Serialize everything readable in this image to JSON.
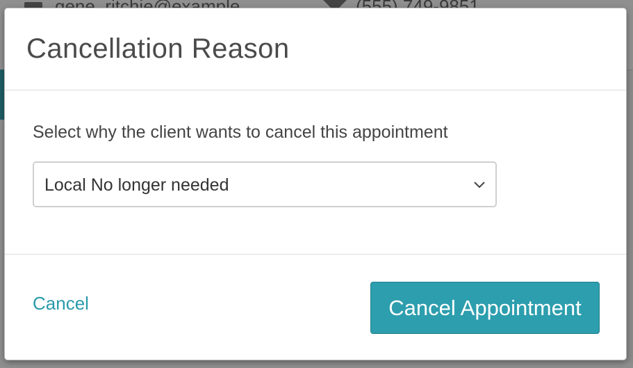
{
  "background": {
    "email": "gene_ritchie@example",
    "phone": "(555) 749-9851"
  },
  "modal": {
    "title": "Cancellation Reason",
    "prompt": "Select why the client wants to cancel this appointment",
    "reason_select": {
      "selected": "Local No longer needed"
    },
    "footer": {
      "cancel_label": "Cancel",
      "confirm_label": "Cancel Appointment"
    }
  },
  "colors": {
    "accent": "#2d9eae",
    "link": "#2a9aaa",
    "overlay": "#8f8f8f"
  },
  "icons": {
    "select_indicator": "chevron-down-icon"
  }
}
